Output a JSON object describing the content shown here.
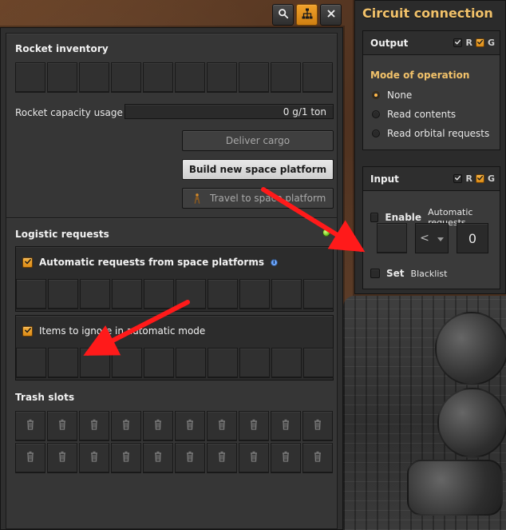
{
  "colors": {
    "accent_orange": "#F0A12A",
    "title_gold": "#F2C26A",
    "status_green": "#7AD12A",
    "arrow_red": "#FF1A1A"
  },
  "top_tools": {
    "search_icon": "search-icon",
    "network_icon": "network-icon",
    "close_icon": "close-icon"
  },
  "main": {
    "sections": {
      "rocket_inventory": "Rocket inventory",
      "logistic_requests": "Logistic requests",
      "trash_slots": "Trash slots"
    },
    "capacity": {
      "label": "Rocket capacity usage",
      "value": "0 g/1 ton"
    },
    "buttons": {
      "deliver_cargo": "Deliver cargo",
      "build_platform": "Build new space platform",
      "travel_platform": "Travel to space platform"
    },
    "logistics": {
      "automatic_requests_label": "Automatic requests from space platforms",
      "ignore_label": "Items to ignore in automatic mode"
    }
  },
  "circuit": {
    "title": "Circuit connection",
    "output": {
      "label": "Output",
      "r_label": "R",
      "g_label": "G",
      "mode_title": "Mode of operation",
      "options": [
        "None",
        "Read contents",
        "Read orbital requests"
      ],
      "selected_index": 0
    },
    "input": {
      "label": "Input",
      "r_label": "R",
      "g_label": "G",
      "enable_label": "Enable",
      "enable_suffix": "Automatic requests",
      "comparator": "<",
      "constant": "0",
      "set_label": "Set",
      "set_suffix": "Blacklist"
    }
  }
}
